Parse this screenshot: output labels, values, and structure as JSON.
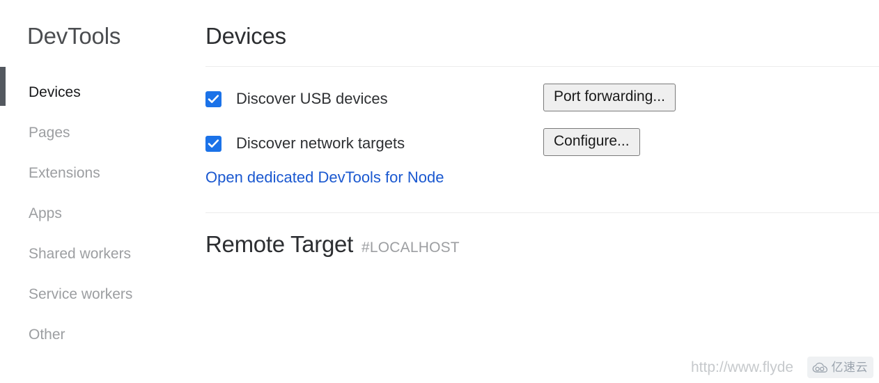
{
  "sidebar": {
    "title": "DevTools",
    "items": [
      {
        "label": "Devices",
        "active": true
      },
      {
        "label": "Pages",
        "active": false
      },
      {
        "label": "Extensions",
        "active": false
      },
      {
        "label": "Apps",
        "active": false
      },
      {
        "label": "Shared workers",
        "active": false
      },
      {
        "label": "Service workers",
        "active": false
      },
      {
        "label": "Other",
        "active": false
      }
    ]
  },
  "main": {
    "page_title": "Devices",
    "settings": [
      {
        "label": "Discover USB devices",
        "checked": true,
        "button": "Port forwarding..."
      },
      {
        "label": "Discover network targets",
        "checked": true,
        "button": "Configure..."
      }
    ],
    "node_link": "Open dedicated DevTools for Node",
    "remote_target": {
      "title": "Remote Target",
      "host": "#LOCALHOST"
    }
  },
  "watermark": {
    "url": "http://www.flyde",
    "badge_text": "亿速云",
    "badge_icon": "cloud-icon"
  },
  "colors": {
    "accent_blue": "#1b72e8",
    "link_blue": "#1a58d0",
    "active_bar": "#53585f",
    "muted_text": "#9c9ea1",
    "divider": "#ececec",
    "button_bg": "#efefef",
    "button_border": "#7a7a7a"
  }
}
